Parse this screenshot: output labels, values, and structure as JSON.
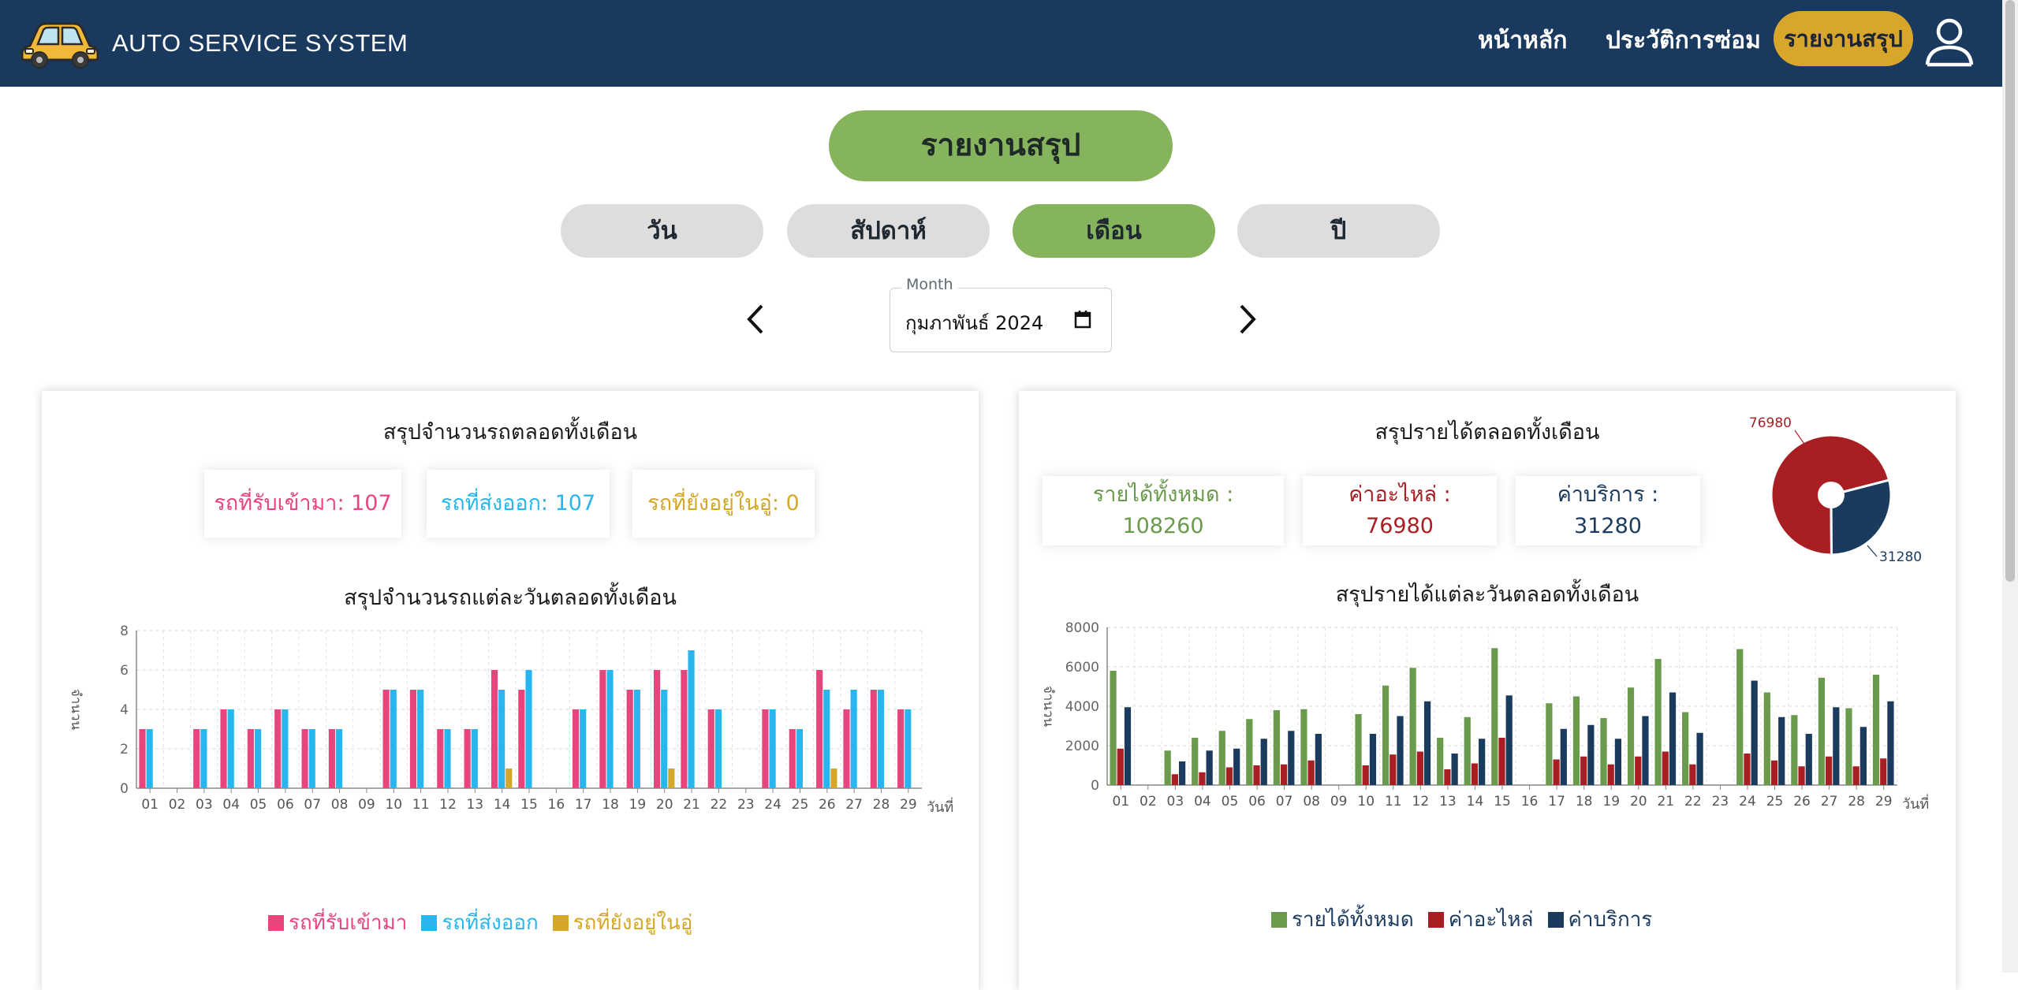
{
  "app": {
    "title": "AUTO SERVICE SYSTEM"
  },
  "nav": {
    "home": "หน้าหลัก",
    "history": "ประวัติการซ่อม",
    "report": "รายงานสรุป"
  },
  "page_title": "รายงานสรุป",
  "tabs": [
    {
      "label": "วัน",
      "active": false
    },
    {
      "label": "สัปดาห์",
      "active": false
    },
    {
      "label": "เดือน",
      "active": true
    },
    {
      "label": "ปี",
      "active": false
    }
  ],
  "month_picker": {
    "label": "Month",
    "value": "กุมภาพันธ์ 2024"
  },
  "colors": {
    "in": "#e8457e",
    "out": "#29b6ee",
    "remain": "#d4a62a",
    "total": "#6a9a4b",
    "parts": "#a81e22",
    "service": "#1a3a5e",
    "nav_bg": "#193a5e",
    "accent": "#86b45d"
  },
  "cars_panel": {
    "title": "สรุปจำนวนรถตลอดทั้งเดือน",
    "stats": [
      {
        "label": "รถที่รับเข้ามา: 107",
        "color": "#e8457e"
      },
      {
        "label": "รถที่ส่งออก: 107",
        "color": "#29b6ee"
      },
      {
        "label": "รถที่ยังอยู่ในอู่: 0",
        "color": "#d4a62a"
      }
    ],
    "daily_title": "สรุปจำนวนรถแต่ละวันตลอดทั้งเดือน",
    "legend": [
      "รถที่รับเข้ามา",
      "รถที่ส่งออก",
      "รถที่ยังอยู่ในอู่"
    ]
  },
  "income_panel": {
    "title": "สรุปรายได้ตลอดทั้งเดือน",
    "stats": [
      {
        "label": "รายได้ทั้งหมด :",
        "value": "108260",
        "color": "#6a9a4b"
      },
      {
        "label": "ค่าอะไหล่ :",
        "value": "76980",
        "color": "#a81e22"
      },
      {
        "label": "ค่าบริการ :",
        "value": "31280",
        "color": "#1a3a5e"
      }
    ],
    "pie_labels": {
      "parts": "76980",
      "service": "31280"
    },
    "daily_title": "สรุปรายได้แต่ละวันตลอดทั้งเดือน",
    "legend": [
      "รายได้ทั้งหมด",
      "ค่าอะไหล่",
      "ค่าบริการ"
    ]
  },
  "chart_data": [
    {
      "type": "bar",
      "xlabel": "วันที่",
      "ylabel": "จำนวน",
      "ylim": [
        0,
        8
      ],
      "yticks": [
        0,
        2,
        4,
        6,
        8
      ],
      "grid": true,
      "legend_position": "bottom",
      "categories": [
        "01",
        "02",
        "03",
        "04",
        "05",
        "06",
        "07",
        "08",
        "09",
        "10",
        "11",
        "12",
        "13",
        "14",
        "15",
        "16",
        "17",
        "18",
        "19",
        "20",
        "21",
        "22",
        "23",
        "24",
        "25",
        "26",
        "27",
        "28",
        "29"
      ],
      "series": [
        {
          "name": "รถที่รับเข้ามา",
          "values": [
            3,
            0,
            3,
            4,
            3,
            4,
            3,
            3,
            0,
            5,
            5,
            3,
            3,
            6,
            5,
            0,
            4,
            6,
            5,
            6,
            6,
            4,
            0,
            4,
            3,
            6,
            4,
            5,
            4
          ]
        },
        {
          "name": "รถที่ส่งออก",
          "values": [
            3,
            0,
            3,
            4,
            3,
            4,
            3,
            3,
            0,
            5,
            5,
            3,
            3,
            5,
            6,
            0,
            4,
            6,
            5,
            5,
            7,
            4,
            0,
            4,
            3,
            5,
            5,
            5,
            4
          ]
        },
        {
          "name": "รถที่ยังอยู่ในอู่",
          "values": [
            0,
            0,
            0,
            0,
            0,
            0,
            0,
            0,
            0,
            0,
            0,
            0,
            0,
            1,
            0,
            0,
            0,
            0,
            0,
            1,
            0,
            0,
            0,
            0,
            0,
            1,
            0,
            0,
            0
          ]
        }
      ]
    },
    {
      "type": "bar",
      "xlabel": "วันที่",
      "ylabel": "จำนวน",
      "ylim": [
        0,
        8000
      ],
      "yticks": [
        0,
        2000,
        4000,
        6000,
        8000
      ],
      "grid": true,
      "legend_position": "bottom",
      "categories": [
        "01",
        "02",
        "03",
        "04",
        "05",
        "06",
        "07",
        "08",
        "09",
        "10",
        "11",
        "12",
        "13",
        "14",
        "15",
        "16",
        "17",
        "18",
        "19",
        "20",
        "21",
        "22",
        "23",
        "24",
        "25",
        "26",
        "27",
        "28",
        "29"
      ],
      "series": [
        {
          "name": "รายได้ทั้งหมด",
          "values": [
            5800,
            0,
            1750,
            2400,
            2750,
            3350,
            3800,
            3850,
            0,
            3600,
            5050,
            5950,
            2400,
            3450,
            6950,
            0,
            4150,
            4500,
            3400,
            4950,
            6400,
            3700,
            0,
            6900,
            4700,
            3550,
            5450,
            3900,
            5600
          ]
        },
        {
          "name": "ค่าอะไหล่",
          "values": [
            1850,
            0,
            550,
            650,
            900,
            1000,
            1050,
            1250,
            0,
            1000,
            1550,
            1700,
            800,
            1100,
            2400,
            0,
            1300,
            1450,
            1050,
            1450,
            1700,
            1050,
            0,
            1600,
            1250,
            950,
            1450,
            950,
            1350
          ]
        },
        {
          "name": "ค่าบริการ",
          "values": [
            3950,
            0,
            1200,
            1750,
            1850,
            2350,
            2750,
            2600,
            0,
            2600,
            3500,
            4250,
            1600,
            2350,
            4550,
            0,
            2850,
            3050,
            2350,
            3500,
            4700,
            2650,
            0,
            5300,
            3450,
            2600,
            3950,
            2950,
            4250
          ]
        }
      ]
    },
    {
      "type": "pie",
      "labels": [
        "ค่าอะไหล่",
        "ค่าบริการ"
      ],
      "values": [
        76980,
        31280
      ]
    }
  ]
}
